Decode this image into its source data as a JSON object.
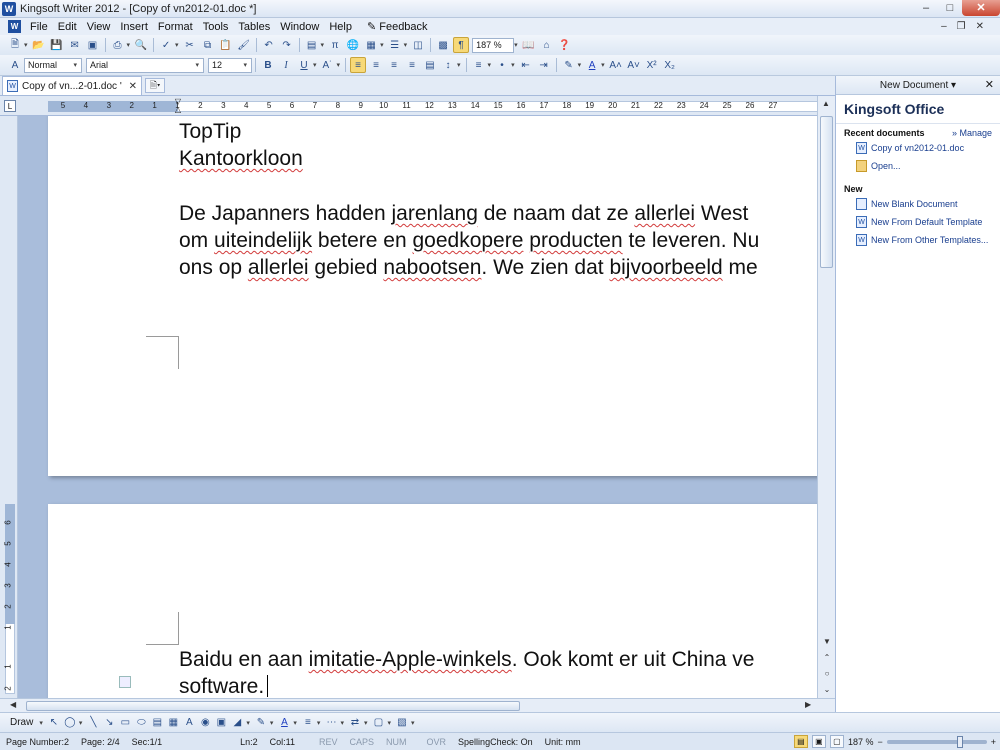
{
  "window": {
    "title": "Kingsoft Writer 2012 - [Copy of vn2012-01.doc *]",
    "logo": "W"
  },
  "menu": {
    "items": [
      "File",
      "Edit",
      "View",
      "Insert",
      "Format",
      "Tools",
      "Tables",
      "Window",
      "Help"
    ],
    "feedback": "Feedback"
  },
  "toolbar": {
    "zoom": "187 %"
  },
  "format_toolbar": {
    "style": "Normal",
    "font": "Arial",
    "size": "12"
  },
  "doc_tab": {
    "label": "Copy of vn...2-01.doc '"
  },
  "ruler": {
    "numbers": [
      "5",
      "4",
      "3",
      "2",
      "1",
      "1",
      "2",
      "3",
      "4",
      "5",
      "6",
      "7",
      "8",
      "9",
      "10",
      "11",
      "12",
      "13",
      "14",
      "15",
      "16",
      "17",
      "18",
      "19",
      "20",
      "21",
      "22",
      "23",
      "24",
      "25",
      "26",
      "27"
    ],
    "vertical_numbers": [
      "6",
      "5",
      "4",
      "3",
      "2",
      "1",
      "1",
      "2"
    ]
  },
  "document": {
    "page1": {
      "heading1": "TopTip",
      "heading2": "Kantoorkloon",
      "para_line1_a": "De Japanners hadden ",
      "para_line1_sq": "jarenlang",
      "para_line1_b": " de naam dat ze ",
      "para_line1_sq2": "allerlei",
      "para_line1_c": " West",
      "para_line2_a": "om ",
      "para_line2_sq": "uiteindelijk",
      "para_line2_b": " betere en ",
      "para_line2_sq2": "goedkopere",
      "para_line2_c": " ",
      "para_line2_sq3": "producten",
      "para_line2_d": " te leveren. Nu",
      "para_line3_a": "ons op ",
      "para_line3_sq": "allerlei",
      "para_line3_b": " gebied ",
      "para_line3_sq2": "nabootsen",
      "para_line3_c": ". We zien dat ",
      "para_line3_sq3": "bijvoorbeeld",
      "para_line3_d": " me"
    },
    "page2": {
      "line1_a": "Baidu en aan ",
      "line1_sq": "imitatie-Apple-winkels",
      "line1_b": ". Ook komt er uit China ve",
      "line2": "software."
    }
  },
  "side_panel": {
    "header": "New Document ▾",
    "title": "Kingsoft Office",
    "recent_title": "Recent documents",
    "manage": "» Manage",
    "recent_doc": "Copy of vn2012-01.doc",
    "open": "Open...",
    "new_title": "New",
    "new_blank": "New Blank Document",
    "new_default": "New From Default Template",
    "new_other": "New From Other Templates..."
  },
  "drawbar": {
    "label": "Draw"
  },
  "status": {
    "page_number": "Page Number:2",
    "page": "Page: 2/4",
    "sec": "Sec:1/1",
    "ln": "Ln:2",
    "col": "Col:11",
    "rev": "REV",
    "caps": "CAPS",
    "num": "NUM",
    "ovr": "OVR",
    "spelling": "SpellingCheck: On",
    "unit": "Unit: mm",
    "zoom": "187 %"
  },
  "colors": {
    "accent": "#1f4fa0",
    "spell_underline": "#d23b3b",
    "workspace": "#a9bddb"
  }
}
